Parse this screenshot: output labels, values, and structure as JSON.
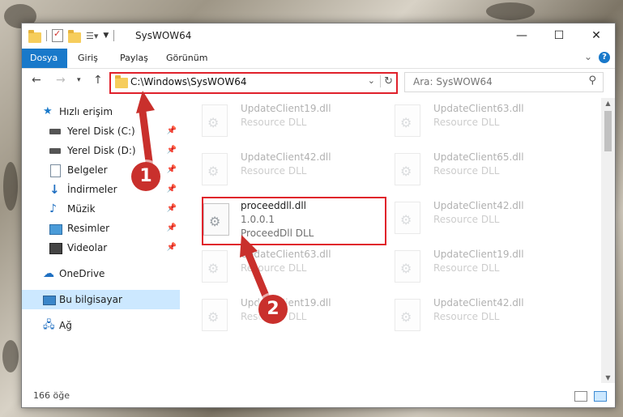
{
  "window": {
    "title": "SysWOW64"
  },
  "ribbon": {
    "tabs": [
      "Dosya",
      "Giriş",
      "Paylaş",
      "Görünüm"
    ],
    "active_tab": "Dosya",
    "help_label": "?"
  },
  "address": {
    "path": "C:\\Windows\\SysWOW64"
  },
  "search": {
    "placeholder": "Ara: SysWOW64"
  },
  "nav": {
    "quick_access": "Hızlı erişim",
    "items": [
      {
        "label": "Yerel Disk (C:)",
        "icon": "drive-icon"
      },
      {
        "label": "Yerel Disk (D:)",
        "icon": "drive-icon"
      },
      {
        "label": "Belgeler",
        "icon": "documents-icon"
      },
      {
        "label": "İndirmeler",
        "icon": "downloads-icon"
      },
      {
        "label": "Müzik",
        "icon": "music-icon"
      },
      {
        "label": "Resimler",
        "icon": "pictures-icon"
      },
      {
        "label": "Videolar",
        "icon": "videos-icon"
      }
    ],
    "onedrive": "OneDrive",
    "this_pc": "Bu bilgisayar",
    "network": "Ağ"
  },
  "files": {
    "left": [
      {
        "name": "UpdateClient19.dll",
        "desc": "Resource DLL"
      },
      {
        "name": "UpdateClient42.dll",
        "desc": "Resource DLL"
      },
      {
        "name": "proceeddll.dll",
        "version": "1.0.0.1",
        "desc": "ProceedDll DLL"
      },
      {
        "name": "UpdateClient63.dll",
        "desc": "Resource DLL"
      },
      {
        "name": "UpdateClient19.dll",
        "desc": "Resource DLL"
      }
    ],
    "right": [
      {
        "name": "UpdateClient63.dll",
        "desc": "Resource DLL"
      },
      {
        "name": "UpdateClient65.dll",
        "desc": "Resource DLL"
      },
      {
        "name": "UpdateClient42.dll",
        "desc": "Resource DLL"
      },
      {
        "name": "UpdateClient19.dll",
        "desc": "Resource DLL"
      },
      {
        "name": "UpdateClient42.dll",
        "desc": "Resource DLL"
      }
    ]
  },
  "status": {
    "count": "166 öğe"
  },
  "annotations": {
    "step1": "1",
    "step2": "2"
  },
  "colors": {
    "accent": "#1979ca",
    "highlight": "#e0212b",
    "badge": "#c9302c"
  }
}
